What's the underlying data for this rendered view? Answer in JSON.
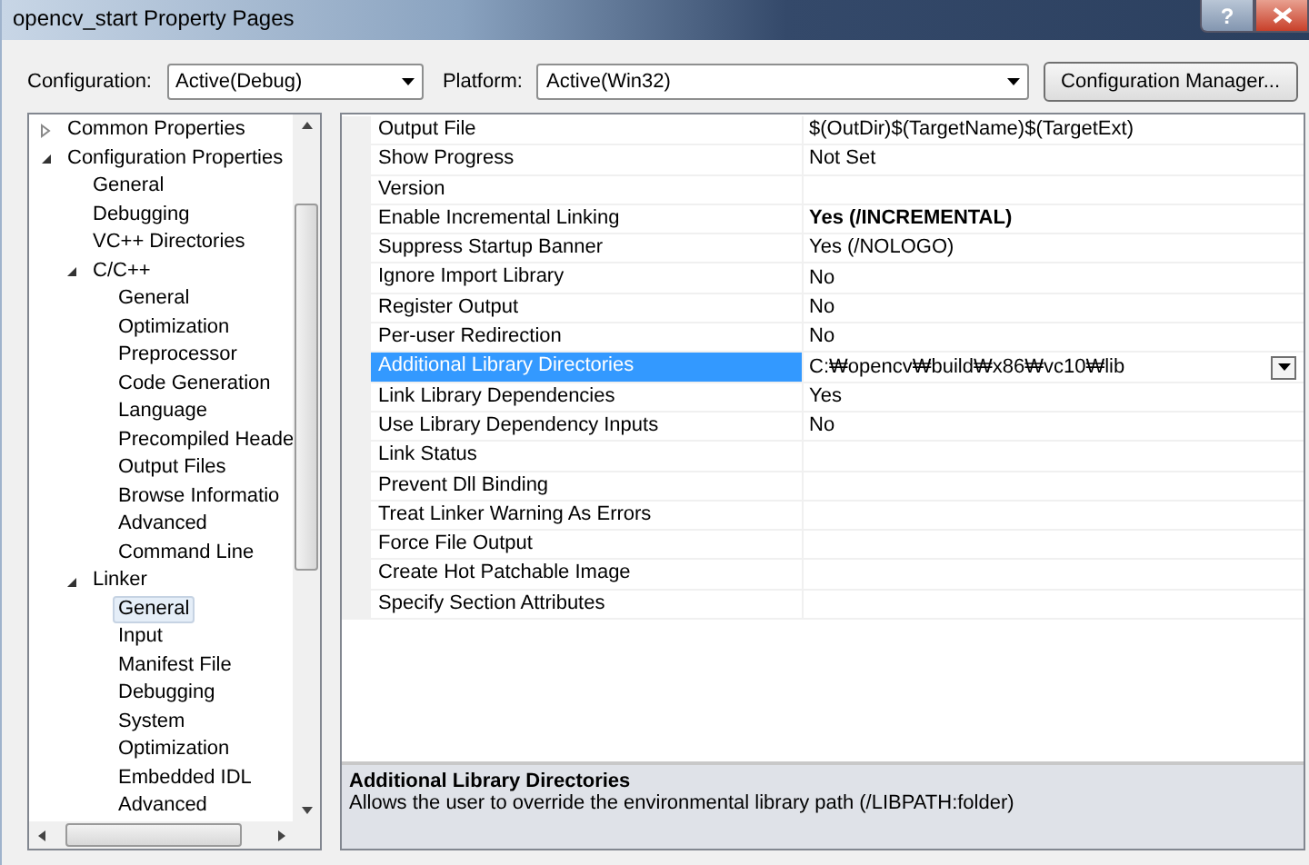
{
  "window": {
    "title": "opencv_start Property Pages",
    "help_button": "?"
  },
  "configuration": {
    "label": "Configuration:",
    "value": "Active(Debug)"
  },
  "platform": {
    "label": "Platform:",
    "value": "Active(Win32)"
  },
  "configuration_manager_button": "Configuration Manager...",
  "tree": [
    {
      "label": "Common Properties",
      "expanded": false,
      "selected": false
    },
    {
      "label": "Configuration Properties",
      "expanded": true,
      "selected": false,
      "children": [
        {
          "label": "General",
          "selected": false
        },
        {
          "label": "Debugging",
          "selected": false
        },
        {
          "label": "VC++ Directories",
          "selected": false
        },
        {
          "label": "C/C++",
          "expanded": true,
          "selected": false,
          "children": [
            {
              "label": "General",
              "selected": false
            },
            {
              "label": "Optimization",
              "selected": false
            },
            {
              "label": "Preprocessor",
              "selected": false
            },
            {
              "label": "Code Generation",
              "selected": false
            },
            {
              "label": "Language",
              "selected": false
            },
            {
              "label": "Precompiled Heade",
              "selected": false
            },
            {
              "label": "Output Files",
              "selected": false
            },
            {
              "label": "Browse Informatio",
              "selected": false
            },
            {
              "label": "Advanced",
              "selected": false
            },
            {
              "label": "Command Line",
              "selected": false
            }
          ]
        },
        {
          "label": "Linker",
          "expanded": true,
          "selected": false,
          "children": [
            {
              "label": "General",
              "selected": true
            },
            {
              "label": "Input",
              "selected": false
            },
            {
              "label": "Manifest File",
              "selected": false
            },
            {
              "label": "Debugging",
              "selected": false
            },
            {
              "label": "System",
              "selected": false
            },
            {
              "label": "Optimization",
              "selected": false
            },
            {
              "label": "Embedded IDL",
              "selected": false
            },
            {
              "label": "Advanced",
              "selected": false
            }
          ]
        }
      ]
    }
  ],
  "properties": [
    {
      "name": "Output File",
      "value": "$(OutDir)$(TargetName)$(TargetExt)",
      "bold": false,
      "selected": false
    },
    {
      "name": "Show Progress",
      "value": "Not Set",
      "bold": false,
      "selected": false
    },
    {
      "name": "Version",
      "bold": false,
      "selected": false
    },
    {
      "name": "Enable Incremental Linking",
      "value": "Yes (/INCREMENTAL)",
      "bold": true,
      "selected": false
    },
    {
      "name": "Suppress Startup Banner",
      "value": "Yes (/NOLOGO)",
      "bold": false,
      "selected": false
    },
    {
      "name": "Ignore Import Library",
      "value": "No",
      "bold": false,
      "selected": false
    },
    {
      "name": "Register Output",
      "value": "No",
      "bold": false,
      "selected": false
    },
    {
      "name": "Per-user Redirection",
      "value": "No",
      "bold": false,
      "selected": false
    },
    {
      "name": "Additional Library Directories",
      "value": "C:₩opencv₩build₩x86₩vc10₩lib",
      "bold": false,
      "selected": true
    },
    {
      "name": "Link Library Dependencies",
      "value": "Yes",
      "bold": false,
      "selected": false
    },
    {
      "name": "Use Library Dependency Inputs",
      "value": "No",
      "bold": false,
      "selected": false
    },
    {
      "name": "Link Status",
      "bold": false,
      "selected": false
    },
    {
      "name": "Prevent Dll Binding",
      "bold": false,
      "selected": false
    },
    {
      "name": "Treat Linker Warning As Errors",
      "bold": false,
      "selected": false
    },
    {
      "name": "Force File Output",
      "bold": false,
      "selected": false
    },
    {
      "name": "Create Hot Patchable Image",
      "bold": false,
      "selected": false
    },
    {
      "name": "Specify Section Attributes",
      "bold": false,
      "selected": false
    }
  ],
  "description": {
    "title": "Additional Library Directories",
    "text": "Allows the user to override the environmental library path (/LIBPATH:folder)"
  }
}
